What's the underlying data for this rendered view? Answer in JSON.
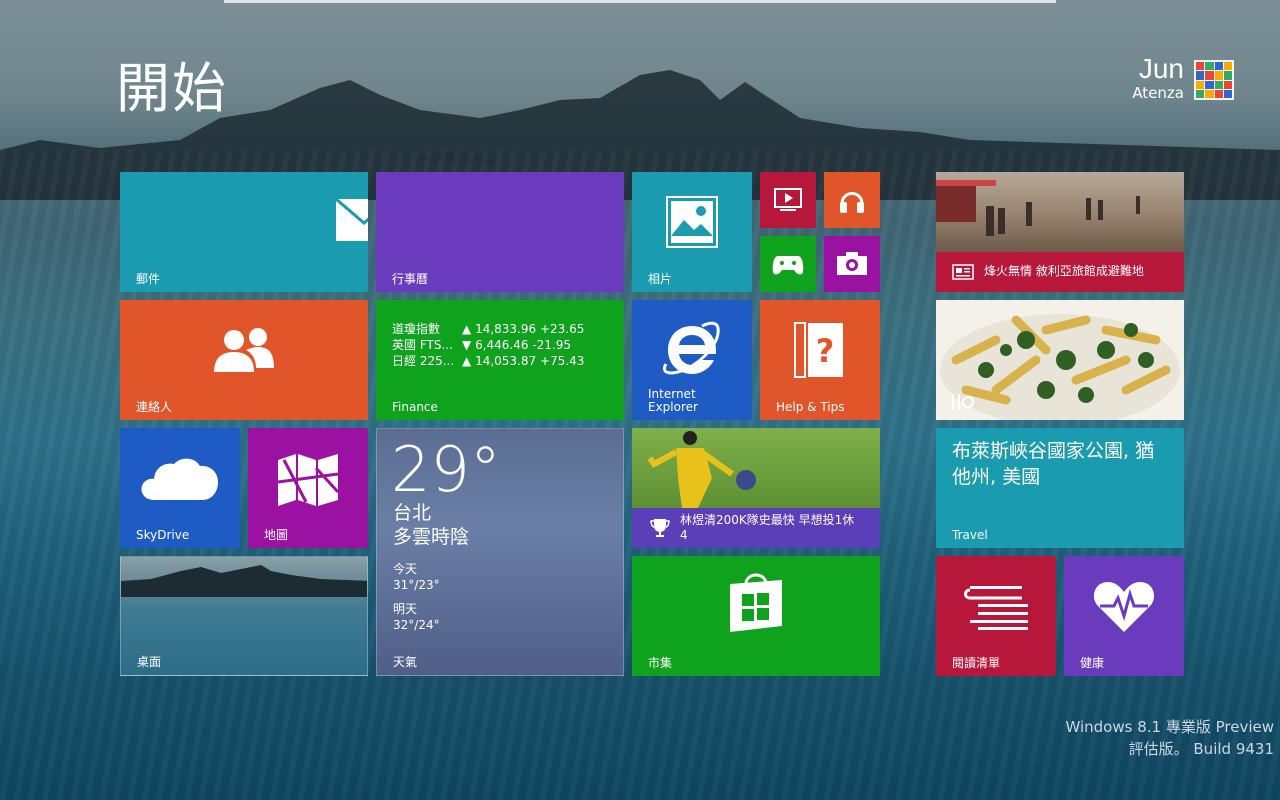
{
  "start": {
    "title": "開始"
  },
  "user": {
    "first_name": "Jun",
    "last_name": "Atenza"
  },
  "tiles": {
    "mail": {
      "label": "郵件"
    },
    "calendar": {
      "label": "行事曆"
    },
    "photos": {
      "label": "相片"
    },
    "contacts": {
      "label": "連絡人"
    },
    "finance": {
      "label": "Finance",
      "rows": [
        {
          "name": "道瓊指數",
          "arrow": "▲",
          "value": "14,833.96 +23.65"
        },
        {
          "name": "英國 FTS...",
          "arrow": "▼",
          "value": "6,446.46 -21.95"
        },
        {
          "name": "日經 225...",
          "arrow": "▲",
          "value": "14,053.87 +75.43"
        }
      ]
    },
    "ie": {
      "label_line1": "Internet",
      "label_line2": "Explorer"
    },
    "help": {
      "label": "Help & Tips"
    },
    "skydrive": {
      "label": "SkyDrive"
    },
    "maps": {
      "label": "地圖"
    },
    "weather": {
      "label": "天氣",
      "temp": "29°",
      "city": "台北",
      "condition": "多雲時陰",
      "today_label": "今天",
      "today_range": "31°/23°",
      "tomorrow_label": "明天",
      "tomorrow_range": "32°/24°"
    },
    "sports": {
      "headline": "林煜清200K隊史最快 早想投1休4"
    },
    "desktop": {
      "label": "桌面"
    },
    "store": {
      "label": "市集"
    },
    "news": {
      "headline": "烽火無情 敘利亞旅館成避難地"
    },
    "travel": {
      "headline": "布萊斯峽谷國家公園, 猶他州, 美國",
      "label": "Travel"
    },
    "reading_list": {
      "label": "閱讀清單"
    },
    "health": {
      "label": "健康"
    }
  },
  "watermark": {
    "line1": "Windows 8.1 專業版 Preview",
    "line2": "評估版。 Build 9431"
  },
  "colors": {
    "mail": "#1a9bb0",
    "calendar": "#6a3bbc",
    "contacts": "#e0552a",
    "finance": "#0ea21d",
    "ie": "#1f5bc4",
    "help": "#e0552a",
    "skydrive": "#1f5bc4",
    "maps": "#9b12a2",
    "store": "#0ea21d",
    "news_band": "#b8173c",
    "travel": "#1a9bb0",
    "reading_list": "#b8173c",
    "health": "#6a3bbc",
    "video": "#b8173c",
    "music": "#e0552a",
    "games": "#0ea21d",
    "camera": "#9b12a2"
  }
}
